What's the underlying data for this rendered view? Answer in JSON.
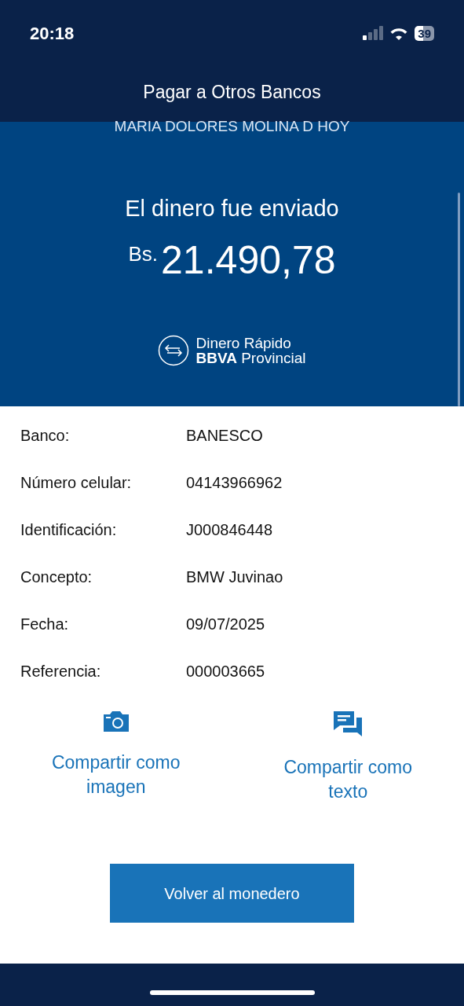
{
  "status_bar": {
    "time": "20:18",
    "battery": "39"
  },
  "header": {
    "title": "Pagar a Otros Bancos"
  },
  "summary": {
    "recipient": "MARIA DOLORES MOLINA D HOY",
    "message": "El dinero fue enviado",
    "currency": "Bs.",
    "amount": "21.490,78",
    "brand_line_1": "Dinero Rápido",
    "brand_line_2": "**BBVA** Provincial"
  },
  "details": [
    {
      "label": "Banco:",
      "value": "BANESCO"
    },
    {
      "label": "Número celular:",
      "value": "04143966962"
    },
    {
      "label": "Identificación:",
      "value": "J000846448"
    },
    {
      "label": "Concepto:",
      "value": "BMW Juvinao"
    },
    {
      "label": "Fecha:",
      "value": "09/07/2025"
    },
    {
      "label": "Referencia:",
      "value": "000003665"
    }
  ],
  "share_actions": [
    {
      "kind": "image",
      "label": "Compartir como imagen"
    },
    {
      "kind": "text",
      "label": "Compartir como texto"
    }
  ],
  "primary_button": "Volver al monedero"
}
